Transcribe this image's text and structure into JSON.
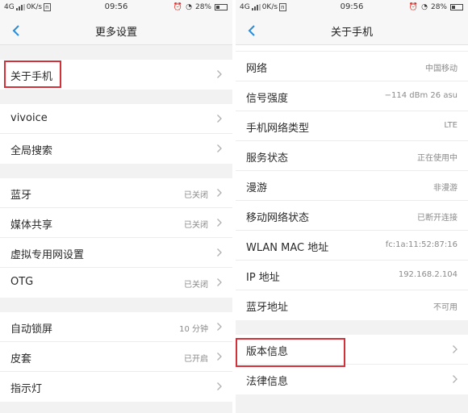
{
  "status": {
    "network": "4G",
    "speed": "0K/s",
    "time": "09:56",
    "battery": "28%"
  },
  "left": {
    "title": "更多设置",
    "groups": [
      [
        {
          "label": "关于手机",
          "value": "",
          "arrow": true
        }
      ],
      [
        {
          "label": "vivoice",
          "value": "",
          "arrow": true
        },
        {
          "label": "全局搜索",
          "value": "",
          "arrow": true
        }
      ],
      [
        {
          "label": "蓝牙",
          "value": "已关闭",
          "arrow": true
        },
        {
          "label": "媒体共享",
          "value": "已关闭",
          "arrow": true
        },
        {
          "label": "虚拟专用网设置",
          "value": "",
          "arrow": true
        },
        {
          "label": "OTG",
          "value": "已关闭",
          "arrow": true
        }
      ],
      [
        {
          "label": "自动锁屏",
          "value": "10 分钟",
          "arrow": true
        },
        {
          "label": "皮套",
          "value": "已开启",
          "arrow": true
        },
        {
          "label": "指示灯",
          "value": "",
          "arrow": true
        }
      ]
    ]
  },
  "right": {
    "title": "关于手机",
    "groups": [
      [
        {
          "label": "网络",
          "value": "中国移动",
          "arrow": false
        },
        {
          "label": "信号强度",
          "value": "−114 dBm  26 asu",
          "arrow": false
        },
        {
          "label": "手机网络类型",
          "value": "LTE",
          "arrow": false
        },
        {
          "label": "服务状态",
          "value": "正在使用中",
          "arrow": false
        },
        {
          "label": "漫游",
          "value": "非漫游",
          "arrow": false
        },
        {
          "label": "移动网络状态",
          "value": "已断开连接",
          "arrow": false
        },
        {
          "label": "WLAN MAC 地址",
          "value": "fc:1a:11:52:87:16",
          "arrow": false
        },
        {
          "label": "IP 地址",
          "value": "192.168.2.104",
          "arrow": false
        },
        {
          "label": "蓝牙地址",
          "value": "不可用",
          "arrow": false
        }
      ],
      [
        {
          "label": "版本信息",
          "value": "",
          "arrow": true
        },
        {
          "label": "法律信息",
          "value": "",
          "arrow": true
        }
      ]
    ]
  },
  "colors": {
    "accent": "#2a8cd9",
    "highlight": "#d3313a"
  }
}
